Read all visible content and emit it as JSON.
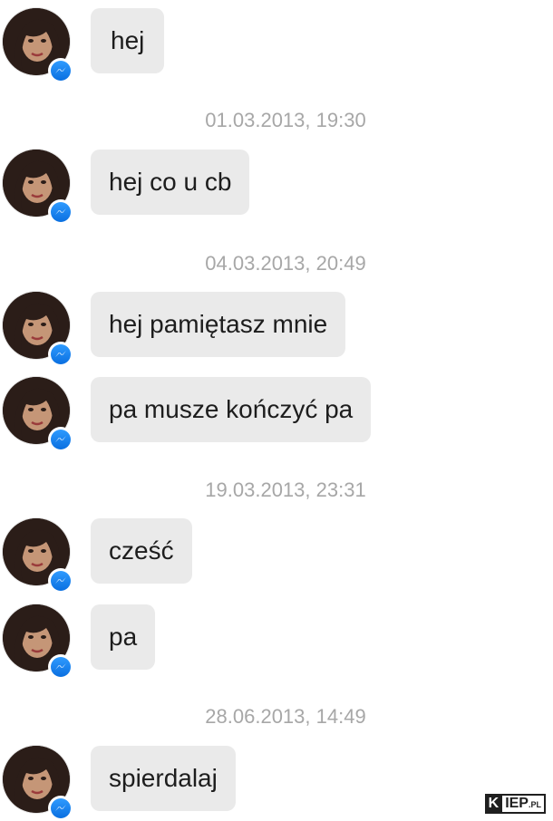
{
  "messages": [
    {
      "type": "message",
      "text": "hej"
    },
    {
      "type": "timestamp",
      "text": "01.03.2013, 19:30"
    },
    {
      "type": "message",
      "text": "hej co u cb"
    },
    {
      "type": "timestamp",
      "text": "04.03.2013, 20:49"
    },
    {
      "type": "message",
      "text": "hej pamiętasz mnie"
    },
    {
      "type": "message",
      "text": "pa musze kończyć pa"
    },
    {
      "type": "timestamp",
      "text": "19.03.2013, 23:31"
    },
    {
      "type": "message",
      "text": "cześć"
    },
    {
      "type": "message",
      "text": "pa"
    },
    {
      "type": "timestamp",
      "text": "28.06.2013, 14:49"
    },
    {
      "type": "message",
      "text": "spierdalaj"
    }
  ],
  "icons": {
    "avatar": "user-avatar",
    "badge": "messenger-icon"
  },
  "colors": {
    "bubble": "#eaeaea",
    "text": "#1d1d1d",
    "timestamp": "#a7a7a7",
    "messenger_blue": "#0a6fe0"
  },
  "watermark": {
    "k": "K",
    "rest": "IEP",
    "suffix": ".PL"
  }
}
